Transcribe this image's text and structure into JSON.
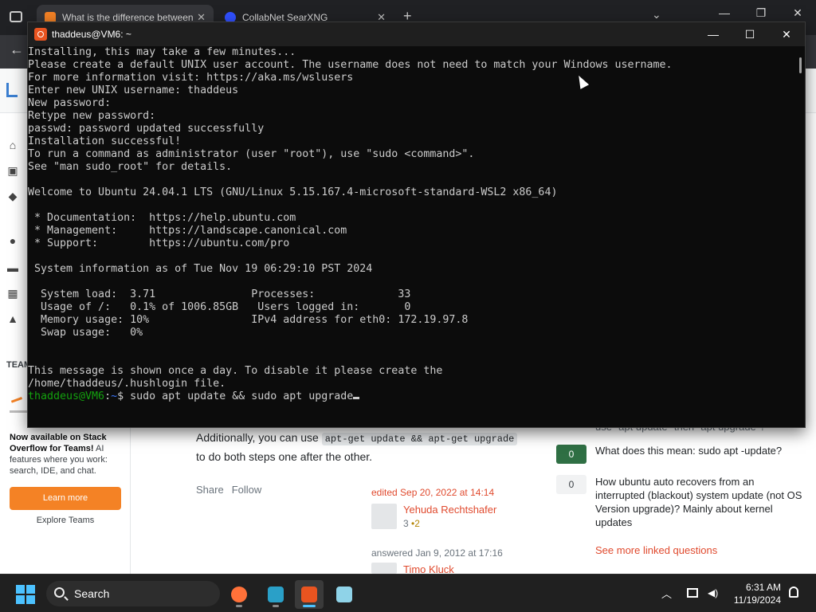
{
  "browser": {
    "tabs": [
      {
        "title": "What is the difference between",
        "close": "✕"
      },
      {
        "title": "CollabNet SearXNG",
        "close": "✕"
      }
    ],
    "new_tab": "+",
    "back": "←"
  },
  "stackoverflow": {
    "teams_label": "TEAM",
    "promo_title": "Now available on Stack Overflow for Teams!",
    "promo_body": " AI features where you work: search, IDE, and chat.",
    "learn_more": "Learn more",
    "explore_teams": "Explore Teams",
    "answer_text_before": "Additionally, you can use ",
    "answer_code": "apt-get update && apt-get upgrade",
    "answer_text_after": "to do both steps one after the other.",
    "share": "Share",
    "follow": "Follow",
    "edited": "edited Sep 20, 2022 at 14:14",
    "editor_name": "Yehuda Rechtshafer",
    "editor_rep": "3",
    "editor_badge": "•2",
    "answered": "answered Jan 9, 2012 at 17:16",
    "answerer_name": "Timo Kluck",
    "partial_question": "use \"apt update\" then \"apt upgrade\"?",
    "linked": [
      {
        "score": "0",
        "title": "What does this mean: sudo apt -update?"
      },
      {
        "score": "0",
        "title": "How ubuntu auto recovers from an interrupted (blackout) system update (not OS Version upgrade)? Mainly about kernel updates"
      }
    ],
    "see_more": "See more linked questions"
  },
  "terminal": {
    "title": "thaddeus@VM6: ~",
    "min": "—",
    "max": "☐",
    "close": "✕",
    "lines": [
      "Installing, this may take a few minutes...",
      "Please create a default UNIX user account. The username does not need to match your Windows username.",
      "For more information visit: https://aka.ms/wslusers",
      "Enter new UNIX username: thaddeus",
      "New password:",
      "Retype new password:",
      "passwd: password updated successfully",
      "Installation successful!",
      "To run a command as administrator (user \"root\"), use \"sudo <command>\".",
      "See \"man sudo_root\" for details.",
      "",
      "Welcome to Ubuntu 24.04.1 LTS (GNU/Linux 5.15.167.4-microsoft-standard-WSL2 x86_64)",
      "",
      " * Documentation:  https://help.ubuntu.com",
      " * Management:     https://landscape.canonical.com",
      " * Support:        https://ubuntu.com/pro",
      "",
      " System information as of Tue Nov 19 06:29:10 PST 2024",
      "",
      "  System load:  3.71               Processes:             33",
      "  Usage of /:   0.1% of 1006.85GB   Users logged in:       0",
      "  Memory usage: 10%                IPv4 address for eth0: 172.19.97.8",
      "  Swap usage:   0%",
      "",
      "",
      "This message is shown once a day. To disable it please create the",
      "/home/thaddeus/.hushlogin file."
    ],
    "prompt_user": "thaddeus@VM6",
    "prompt_sep": ":",
    "prompt_path": "~",
    "prompt_symbol": "$ ",
    "command": "sudo apt update && sudo apt upgrade"
  },
  "taskbar": {
    "search_label": "Search",
    "time": "6:31 AM",
    "date": "11/19/2024",
    "apps": [
      {
        "name": "firefox-icon",
        "color": "#ff7139"
      },
      {
        "name": "code-editor-icon",
        "color": "#2aa0c8"
      },
      {
        "name": "ubuntu-icon",
        "color": "#e95420"
      },
      {
        "name": "notepad-icon",
        "color": "#8fd3e8"
      }
    ]
  },
  "colors": {
    "terminal_bg": "#0c0c0c",
    "prompt_green": "#13a10e",
    "prompt_blue": "#3b78ff",
    "accent_orange": "#f48225"
  }
}
